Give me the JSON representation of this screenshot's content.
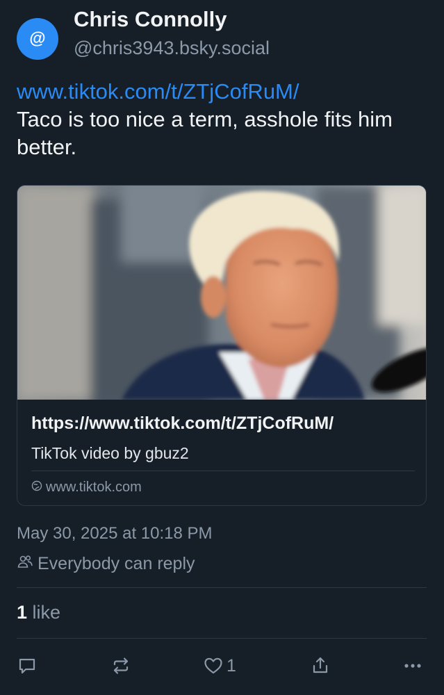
{
  "author": {
    "display_name": "Chris Connolly",
    "handle": "@chris3943.bsky.social",
    "avatar_icon": "at-sign-icon",
    "avatar_glyph": "@",
    "avatar_color": "#2a8bf5"
  },
  "post": {
    "link_text": "www.tiktok.com/t/ZTjCofRuM/",
    "body": "Taco is too nice a term, asshole fits him better."
  },
  "embed_card": {
    "thumbnail": "photo",
    "url": "https://www.tiktok.com/t/ZTjCofRuM/",
    "description": "TikTok video by gbuz2",
    "domain_icon": "globe-icon",
    "domain": "www.tiktok.com"
  },
  "meta": {
    "timestamp": "May 30, 2025 at 10:18 PM",
    "reply_icon": "people-icon",
    "reply_setting": "Everybody can reply"
  },
  "engagement": {
    "like_count": "1",
    "like_label": "like"
  },
  "actions": {
    "reply_icon": "reply-bubble-icon",
    "repost_icon": "repost-icon",
    "like_icon": "heart-icon",
    "like_count": "1",
    "share_icon": "share-icon",
    "more_icon": "more-dots-icon"
  },
  "colors": {
    "background": "#161e27",
    "accent": "#2a8bf5",
    "muted_text": "#8b99a8",
    "border": "#2d3845"
  }
}
